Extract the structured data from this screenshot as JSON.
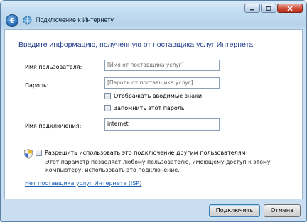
{
  "window": {
    "title": "Подключение к Интернету"
  },
  "form": {
    "heading": "Введите информацию, полученную от поставщика услуг Интернета",
    "username": {
      "label": "Имя пользователя:",
      "placeholder": "[Имя от поставщика услуг]"
    },
    "password": {
      "label": "Пароль:",
      "placeholder": "[Пароль от поставщика услуг]"
    },
    "show_chars_label": "Отображать вводимые знаки",
    "remember_label": "Запомнить этот пароль",
    "connection_name": {
      "label": "Имя подключения:",
      "value": "internet"
    },
    "allow_others": {
      "label": "Разрешить использовать это подключение другим пользователям",
      "description": "Этот параметр позволяет любому пользователю, имеющему доступ к этому компьютеру, использовать это подключение."
    },
    "isp_link": "Нет поставщика услуг Интернета (ISP)"
  },
  "buttons": {
    "connect": "Подключить",
    "cancel": "Отмена"
  },
  "icons": {
    "back": "back-arrow-icon",
    "title": "globe-network-icon",
    "shield": "uac-shield-icon"
  },
  "colors": {
    "heading": "#1f3a8a",
    "link": "#1a5fb4"
  }
}
